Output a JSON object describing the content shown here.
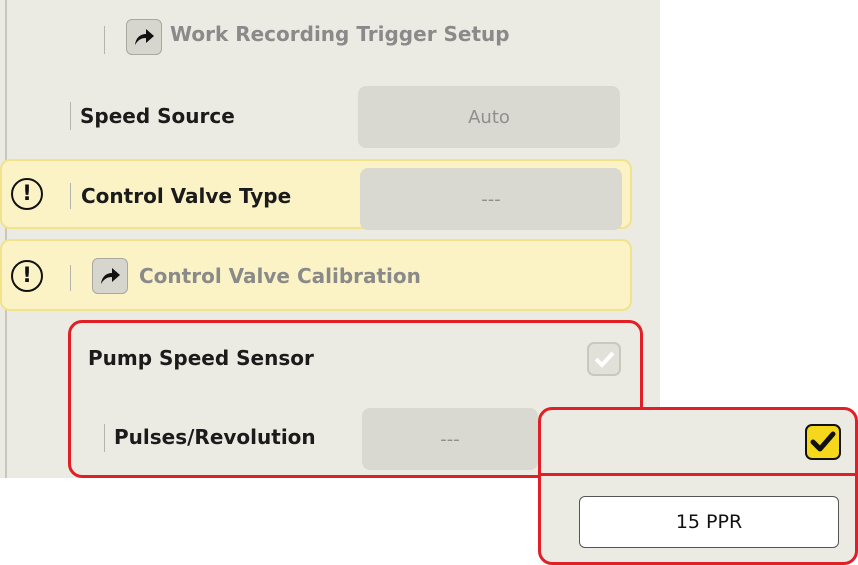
{
  "settings": {
    "work_recording": {
      "label": "Work Recording Trigger Setup",
      "icon": "arrow-link-icon"
    },
    "speed_source": {
      "label": "Speed Source",
      "value": "Auto"
    },
    "control_valve_type": {
      "label": "Control Valve Type",
      "value": "---",
      "status_icon": "warning-icon"
    },
    "control_valve_calibration": {
      "label": "Control Valve Calibration",
      "icon": "arrow-link-icon",
      "status_icon": "warning-icon"
    },
    "pump_speed_sensor": {
      "label": "Pump Speed Sensor",
      "checked": false
    },
    "pulses_per_revolution": {
      "label": "Pulses/Revolution",
      "value": "---"
    }
  },
  "callout": {
    "checkbox_checked": true,
    "value": "15 PPR"
  },
  "colors": {
    "highlight": "#e01f26",
    "warning_bg": "#fbf3c6",
    "checkbox_checked": "#f5d81c"
  }
}
